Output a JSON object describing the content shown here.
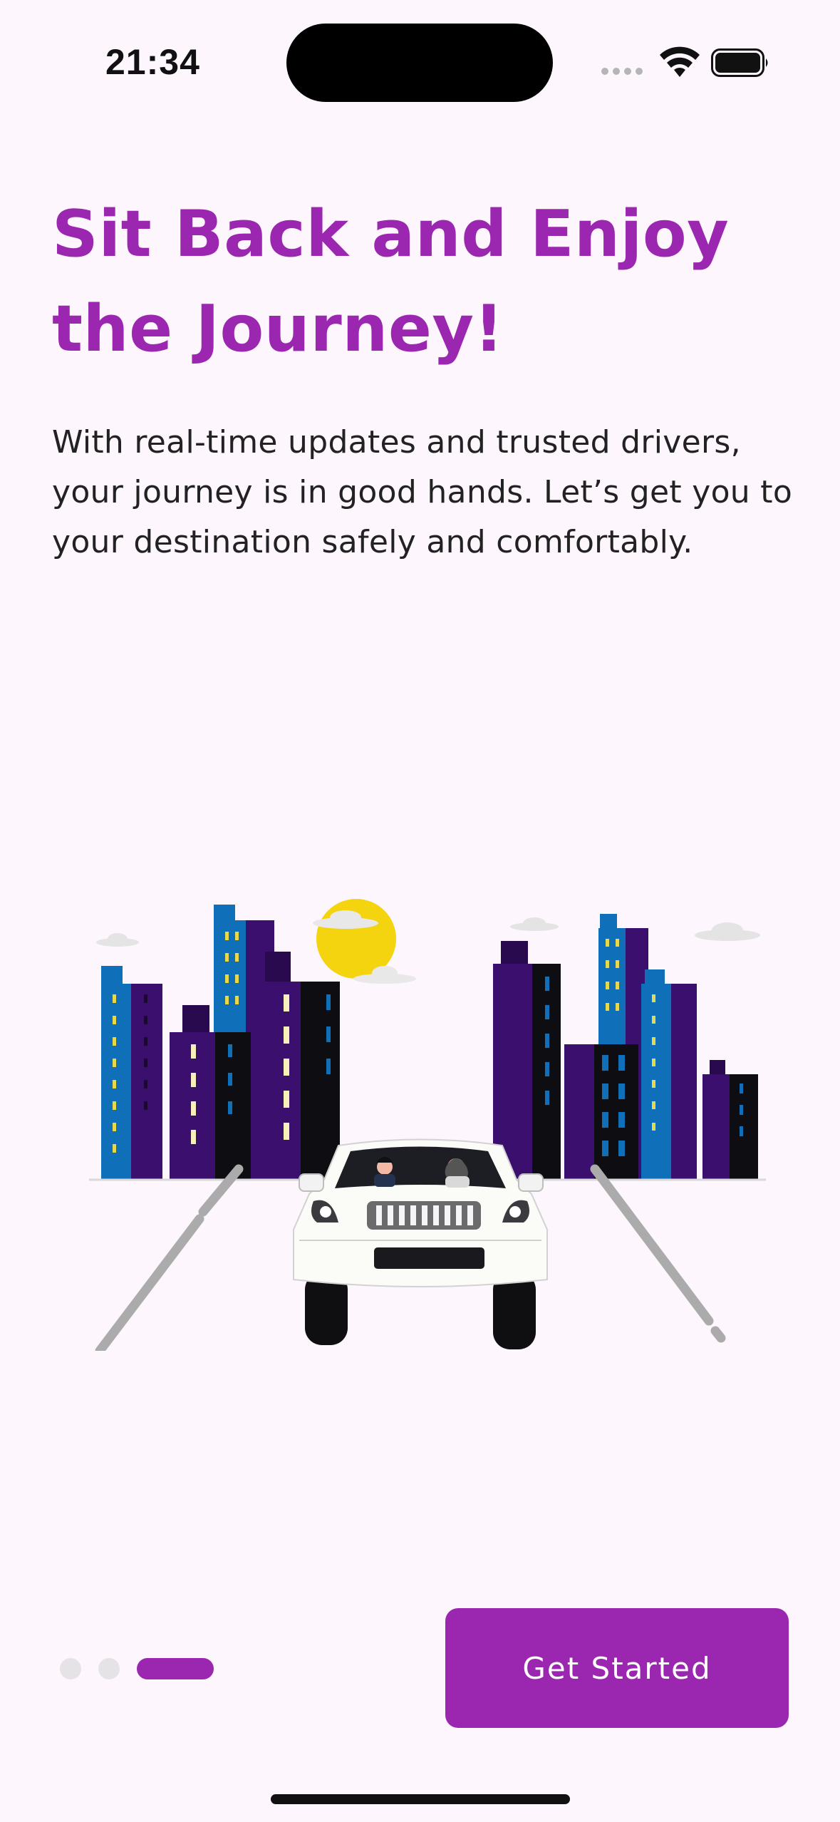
{
  "status_bar": {
    "time": "21:34"
  },
  "onboarding": {
    "title": "Sit Back and Enjoy the Journey!",
    "description": "With real-time updates and trusted drivers, your journey is in good hands. Let’s get you to your destination safely and comfortably.",
    "page_count": 3,
    "current_page": 3,
    "cta_label": "Get Started"
  },
  "colors": {
    "accent": "#9b27b0",
    "background": "#fdf6fd",
    "text": "#222222",
    "inactive_dot": "#e6e3e6"
  },
  "icons": {
    "signal": "cellular-signal-icon",
    "wifi": "wifi-icon",
    "battery": "battery-icon"
  }
}
